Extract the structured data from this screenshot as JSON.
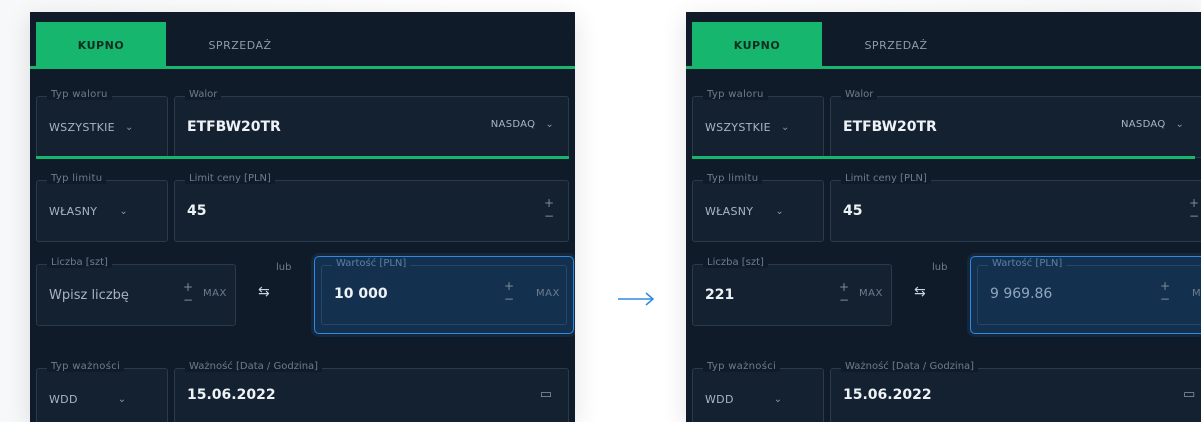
{
  "colors": {
    "accent": "#16b66e",
    "highlight": "#2f8ae0",
    "panel_bg": "#0f1b28"
  },
  "left": {
    "tab_buy": "KUPNO",
    "tab_sell": "SPRZEDAŻ",
    "asset_type_label": "Typ waloru",
    "asset_type_value": "WSZYSTKIE",
    "asset_label": "Walor",
    "asset_value": "ETFBW20TR",
    "exchange_value": "NASDAQ",
    "limit_type_label": "Typ limitu",
    "limit_type_value": "WŁASNY",
    "price_limit_label": "Limit ceny [PLN]",
    "price_limit_value": "45",
    "quantity_label": "Liczba [szt]",
    "quantity_placeholder": "Wpisz liczbę",
    "max_label": "MAX",
    "or_label": "lub",
    "value_label": "Wartość [PLN]",
    "value_value": "10 000",
    "value_max_label": "MAX",
    "validity_type_label": "Typ ważności",
    "validity_type_value": "WDD",
    "validity_label": "Ważność [Data / Godzina]",
    "validity_value": "15.06.2022"
  },
  "right": {
    "tab_buy": "KUPNO",
    "tab_sell": "SPRZEDAŻ",
    "asset_type_label": "Typ waloru",
    "asset_type_value": "WSZYSTKIE",
    "asset_label": "Walor",
    "asset_value": "ETFBW20TR",
    "exchange_value": "NASDAQ",
    "limit_type_label": "Typ limitu",
    "limit_type_value": "WŁASNY",
    "price_limit_label": "Limit ceny [PLN]",
    "price_limit_value": "45",
    "quantity_label": "Liczba [szt]",
    "quantity_value": "221",
    "max_label": "MAX",
    "or_label": "lub",
    "value_label": "Wartość [PLN]",
    "value_value": "9 969.86",
    "value_max_label": "MA",
    "validity_type_label": "Typ ważności",
    "validity_type_value": "WDD",
    "validity_label": "Ważność [Data / Godzina]",
    "validity_value": "15.06.2022"
  },
  "icons": {
    "chevron": "chevron-down-icon",
    "swap": "swap-icon",
    "calendar": "calendar-icon",
    "arrow": "arrow-right-icon"
  }
}
